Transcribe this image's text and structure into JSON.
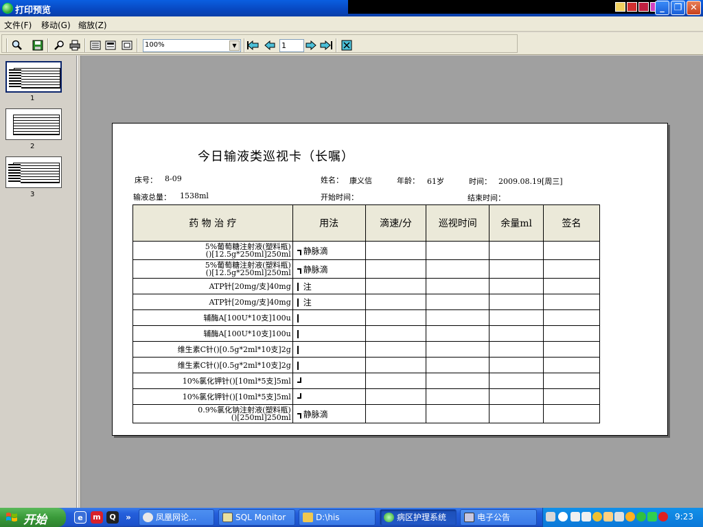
{
  "window": {
    "title": "打印预览"
  },
  "menu": {
    "items": [
      "文件(F)",
      "移动(G)",
      "缩放(Z)"
    ]
  },
  "toolbar": {
    "zoom_value": "100%",
    "page_value": "1"
  },
  "thumbnails": [
    {
      "label": "1"
    },
    {
      "label": "2"
    },
    {
      "label": "3"
    }
  ],
  "document": {
    "title": "今日输液类巡视卡（长嘱）",
    "bed_label": "床号：",
    "bed_value": "8-09",
    "name_label": "姓名：",
    "name_value": "康义信",
    "age_label": "年龄：",
    "age_value": "61岁",
    "time_label": "时间：",
    "time_value": "2009.08.19[周三]",
    "total_label": "输液总量：",
    "total_value": "1538ml",
    "start_label": "开始时间：",
    "end_label": "结束时间：",
    "table": {
      "headers": [
        "药 物 治 疗",
        "用法",
        "滴速/分",
        "巡视时间",
        "余量ml",
        "签名"
      ],
      "rows": [
        {
          "drug": "5%葡萄糖注射液(塑料瓶)\n()[12.5g*250ml]250ml",
          "usage": "静脉滴",
          "bracket": "top"
        },
        {
          "drug": "5%葡萄糖注射液(塑料瓶)\n()[12.5g*250ml]250ml",
          "usage": "静脉滴",
          "bracket": "top"
        },
        {
          "drug": "ATP针[20mg/支]40mg",
          "usage": "注",
          "bracket": "mid"
        },
        {
          "drug": "ATP针[20mg/支]40mg",
          "usage": "注",
          "bracket": "mid"
        },
        {
          "drug": "辅酶A[100U*10支]100u",
          "usage": "",
          "bracket": "mid"
        },
        {
          "drug": "辅酶A[100U*10支]100u",
          "usage": "",
          "bracket": "mid"
        },
        {
          "drug": "维生素C针()[0.5g*2ml*10支]2g",
          "usage": "",
          "bracket": "mid"
        },
        {
          "drug": "维生素C针()[0.5g*2ml*10支]2g",
          "usage": "",
          "bracket": "mid"
        },
        {
          "drug": "10%氯化钾针()[10ml*5支]5ml",
          "usage": "",
          "bracket": "bot"
        },
        {
          "drug": "10%氯化钾针()[10ml*5支]5ml",
          "usage": "",
          "bracket": "bot"
        },
        {
          "drug": "0.9%氯化钠注射液(塑料瓶)\n()[250ml]250ml",
          "usage": "静脉滴",
          "bracket": "top"
        }
      ]
    }
  },
  "taskbar": {
    "start_label": "开始",
    "tasks": [
      {
        "label": "凤凰网论..."
      },
      {
        "label": "SQL Monitor"
      },
      {
        "label": "D:\\his"
      },
      {
        "label": "病区护理系统"
      },
      {
        "label": "电子公告"
      }
    ],
    "clock": "9:23"
  }
}
